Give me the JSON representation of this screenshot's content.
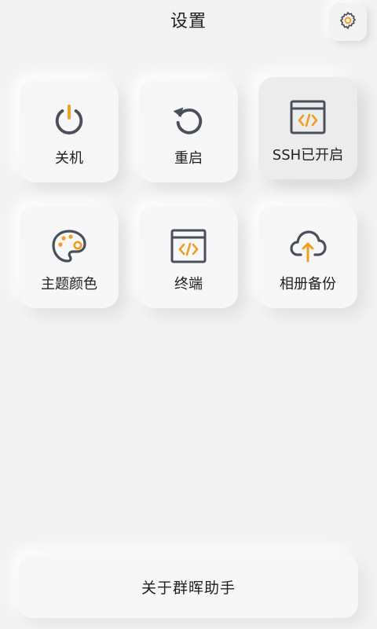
{
  "header": {
    "title": "设置"
  },
  "tiles": [
    {
      "label": "关机",
      "icon": "power-icon"
    },
    {
      "label": "重启",
      "icon": "restart-icon"
    },
    {
      "label": "SSH已开启",
      "icon": "code-window-icon",
      "active": true
    },
    {
      "label": "主题颜色",
      "icon": "palette-icon"
    },
    {
      "label": "终端",
      "icon": "terminal-icon"
    },
    {
      "label": "相册备份",
      "icon": "cloud-upload-icon"
    }
  ],
  "footer": {
    "about_label": "关于群晖助手"
  },
  "colors": {
    "accent": "#f0a020",
    "icon_stroke": "#4a4f5c",
    "background": "#f3f3f3"
  }
}
